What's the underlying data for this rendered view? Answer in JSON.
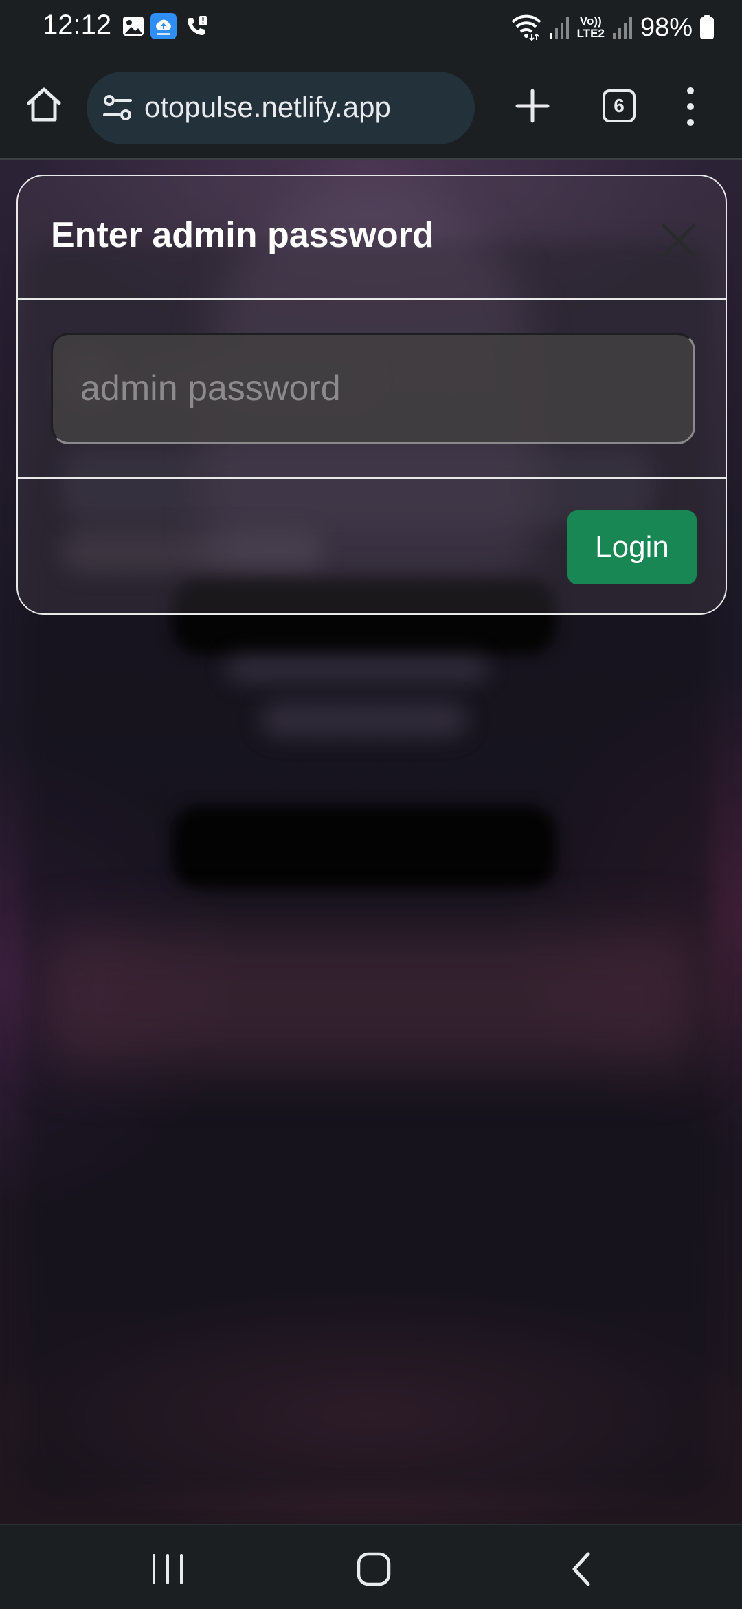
{
  "status_bar": {
    "time": "12:12",
    "battery_percent": "98%",
    "network_label_top": "Vo))",
    "network_label_bottom": "LTE2",
    "notification_icons": [
      "gallery-icon",
      "cloud-upload-icon",
      "missed-call-icon"
    ],
    "battery_level": 0.98
  },
  "browser": {
    "url": "otopulse.netlify.app",
    "tab_count": "6"
  },
  "modal": {
    "title": "Enter admin password",
    "input_placeholder": "admin password",
    "input_value": "",
    "login_label": "Login"
  },
  "colors": {
    "login_button": "#198754",
    "modal_border": "#e9e9ea",
    "system_bar": "#1b1f22"
  }
}
